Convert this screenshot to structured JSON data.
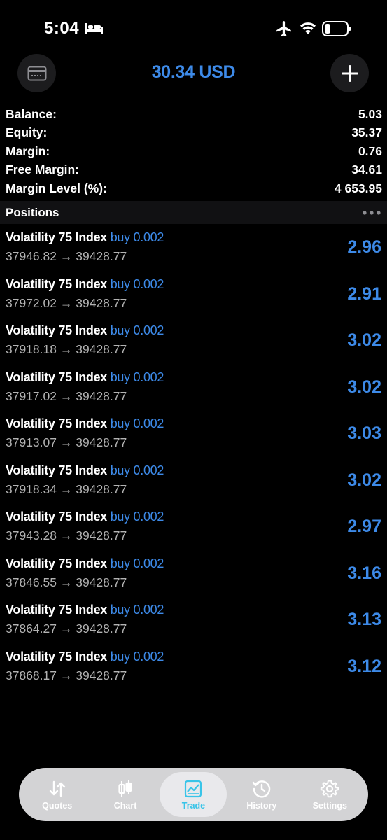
{
  "status_bar": {
    "time": "5:04",
    "icons": [
      "bed-icon",
      "airplane-icon",
      "wifi-icon",
      "battery-icon"
    ]
  },
  "header": {
    "title": "30.34 USD",
    "left_icon": "accounts-card-icon",
    "right_icon": "plus-icon"
  },
  "summary": [
    {
      "label": "Balance:",
      "value": "5.03"
    },
    {
      "label": "Equity:",
      "value": "35.37"
    },
    {
      "label": "Margin:",
      "value": "0.76"
    },
    {
      "label": "Free Margin:",
      "value": "34.61"
    },
    {
      "label": "Margin Level (%):",
      "value": "4 653.95"
    }
  ],
  "positions": {
    "title": "Positions",
    "items": [
      {
        "symbol": "Volatility 75 Index",
        "side": "buy",
        "volume": "0.002",
        "open": "37946.82",
        "arrow": "→",
        "current": "39428.77",
        "profit": "2.96"
      },
      {
        "symbol": "Volatility 75 Index",
        "side": "buy",
        "volume": "0.002",
        "open": "37972.02",
        "arrow": "→",
        "current": "39428.77",
        "profit": "2.91"
      },
      {
        "symbol": "Volatility 75 Index",
        "side": "buy",
        "volume": "0.002",
        "open": "37918.18",
        "arrow": "→",
        "current": "39428.77",
        "profit": "3.02"
      },
      {
        "symbol": "Volatility 75 Index",
        "side": "buy",
        "volume": "0.002",
        "open": "37917.02",
        "arrow": "→",
        "current": "39428.77",
        "profit": "3.02"
      },
      {
        "symbol": "Volatility 75 Index",
        "side": "buy",
        "volume": "0.002",
        "open": "37913.07",
        "arrow": "→",
        "current": "39428.77",
        "profit": "3.03"
      },
      {
        "symbol": "Volatility 75 Index",
        "side": "buy",
        "volume": "0.002",
        "open": "37918.34",
        "arrow": "→",
        "current": "39428.77",
        "profit": "3.02"
      },
      {
        "symbol": "Volatility 75 Index",
        "side": "buy",
        "volume": "0.002",
        "open": "37943.28",
        "arrow": "→",
        "current": "39428.77",
        "profit": "2.97"
      },
      {
        "symbol": "Volatility 75 Index",
        "side": "buy",
        "volume": "0.002",
        "open": "37846.55",
        "arrow": "→",
        "current": "39428.77",
        "profit": "3.16"
      },
      {
        "symbol": "Volatility 75 Index",
        "side": "buy",
        "volume": "0.002",
        "open": "37864.27",
        "arrow": "→",
        "current": "39428.77",
        "profit": "3.13"
      },
      {
        "symbol": "Volatility 75 Index",
        "side": "buy",
        "volume": "0.002",
        "open": "37868.17",
        "arrow": "→",
        "current": "39428.77",
        "profit": "3.12"
      }
    ]
  },
  "tabs": [
    {
      "label": "Quotes",
      "icon": "quotes-arrows-icon",
      "active": false
    },
    {
      "label": "Chart",
      "icon": "candlestick-icon",
      "active": false
    },
    {
      "label": "Trade",
      "icon": "trade-chart-icon",
      "active": true
    },
    {
      "label": "History",
      "icon": "history-clock-icon",
      "active": false
    },
    {
      "label": "Settings",
      "icon": "gear-icon",
      "active": false
    }
  ],
  "colors": {
    "accent": "#3d8ae8",
    "active_tab": "#39c4e8",
    "background": "#000000",
    "tab_bar": "#d3d3d5"
  }
}
